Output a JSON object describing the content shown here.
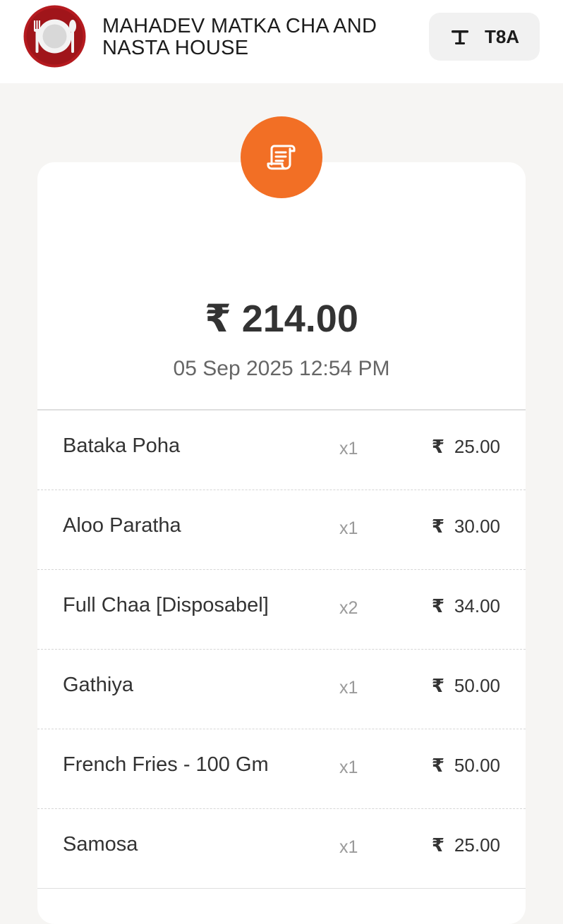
{
  "header": {
    "restaurant_name": "MAHADEV MATKA CHA AND NASTA HOUSE",
    "logo_icon": "plate-fork-spoon-icon",
    "table_icon": "table-icon",
    "table_label": "T8A"
  },
  "receipt": {
    "icon": "receipt-scroll-icon",
    "total": "₹ 214.00",
    "datetime": "05 Sep 2025 12:54 PM",
    "currency_symbol": "₹",
    "items": [
      {
        "name": "Bataka Poha",
        "qty": "x1",
        "price": "25.00"
      },
      {
        "name": "Aloo Paratha",
        "qty": "x1",
        "price": "30.00"
      },
      {
        "name": "Full Chaa [Disposabel]",
        "qty": "x2",
        "price": "34.00"
      },
      {
        "name": "Gathiya",
        "qty": "x1",
        "price": "50.00"
      },
      {
        "name": "French Fries - 100 Gm",
        "qty": "x1",
        "price": "50.00"
      },
      {
        "name": "Samosa",
        "qty": "x1",
        "price": "25.00"
      }
    ]
  },
  "colors": {
    "accent": "#f26f25",
    "logo_red": "#b51a1f",
    "background": "#f6f5f3"
  }
}
